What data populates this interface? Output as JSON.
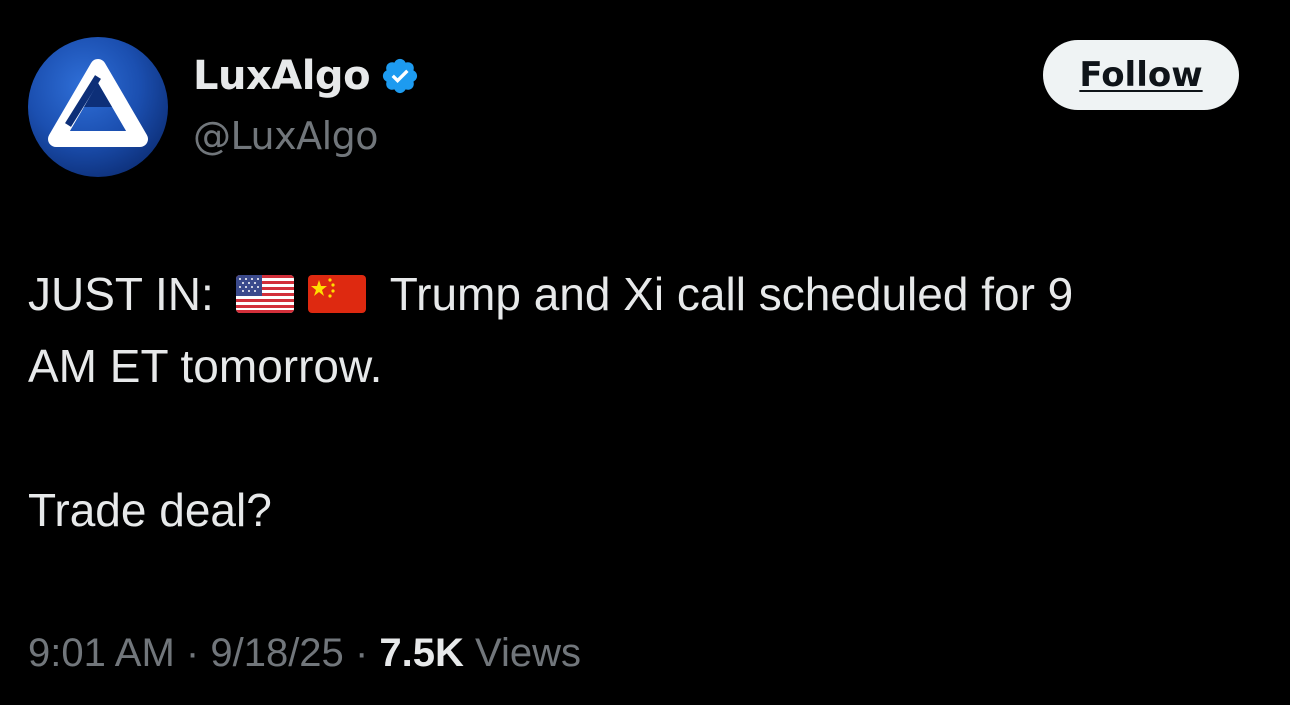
{
  "author": {
    "display_name": "LuxAlgo",
    "handle": "@LuxAlgo",
    "verified": true,
    "avatar_icon": "luxalgo-logo-icon",
    "verified_icon": "verified-badge-icon"
  },
  "follow_button": {
    "label": "Follow"
  },
  "tweet": {
    "line1_prefix": "JUST IN:",
    "flags": [
      "us-flag-icon",
      "china-flag-icon"
    ],
    "line1_suffix": "Trump and Xi call scheduled for 9",
    "line2": "AM ET tomorrow.",
    "line3": "Trade deal?"
  },
  "meta": {
    "time": "9:01 AM",
    "separator1": "·",
    "date": "9/18/25",
    "separator2": "·",
    "views_count": "7.5K",
    "views_label": "Views"
  },
  "colors": {
    "background": "#000000",
    "text_primary": "#e7e9ea",
    "text_secondary": "#71767b",
    "verified_blue": "#1d9bf0",
    "follow_bg": "#eff3f4"
  }
}
